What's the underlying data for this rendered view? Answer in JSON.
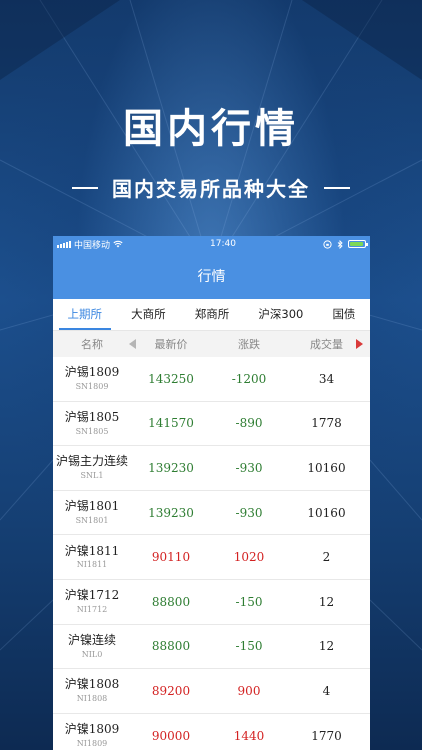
{
  "hero": {
    "title": "国内行情",
    "subtitle": "国内交易所品种大全"
  },
  "status_bar": {
    "carrier": "中国移动",
    "time": "17:40",
    "battery_level": 0.9
  },
  "nav": {
    "title": "行情"
  },
  "tabs": [
    {
      "label": "上期所",
      "active": true
    },
    {
      "label": "大商所",
      "active": false
    },
    {
      "label": "郑商所",
      "active": false
    },
    {
      "label": "沪深300",
      "active": false
    },
    {
      "label": "国债",
      "active": false
    }
  ],
  "columns": [
    "名称",
    "最新价",
    "涨跌",
    "成交量"
  ],
  "rows": [
    {
      "name": "沪锡1809",
      "code": "SN1809",
      "price": "143250",
      "change": "-1200",
      "volume": "34",
      "direction": "down"
    },
    {
      "name": "沪锡1805",
      "code": "SN1805",
      "price": "141570",
      "change": "-890",
      "volume": "1778",
      "direction": "down"
    },
    {
      "name": "沪锡主力连续",
      "code": "SNL1",
      "price": "139230",
      "change": "-930",
      "volume": "10160",
      "direction": "down"
    },
    {
      "name": "沪锡1801",
      "code": "SN1801",
      "price": "139230",
      "change": "-930",
      "volume": "10160",
      "direction": "down"
    },
    {
      "name": "沪镍1811",
      "code": "NI1811",
      "price": "90110",
      "change": "1020",
      "volume": "2",
      "direction": "up"
    },
    {
      "name": "沪镍1712",
      "code": "NI1712",
      "price": "88800",
      "change": "-150",
      "volume": "12",
      "direction": "down"
    },
    {
      "name": "沪镍连续",
      "code": "NIL0",
      "price": "88800",
      "change": "-150",
      "volume": "12",
      "direction": "down"
    },
    {
      "name": "沪镍1808",
      "code": "NI1808",
      "price": "89200",
      "change": "900",
      "volume": "4",
      "direction": "up"
    },
    {
      "name": "沪镍1809",
      "code": "NI1809",
      "price": "90000",
      "change": "1440",
      "volume": "1770",
      "direction": "up"
    }
  ],
  "colors": {
    "accent": "#4a90e2",
    "up": "#d32222",
    "down": "#2e7d32"
  }
}
